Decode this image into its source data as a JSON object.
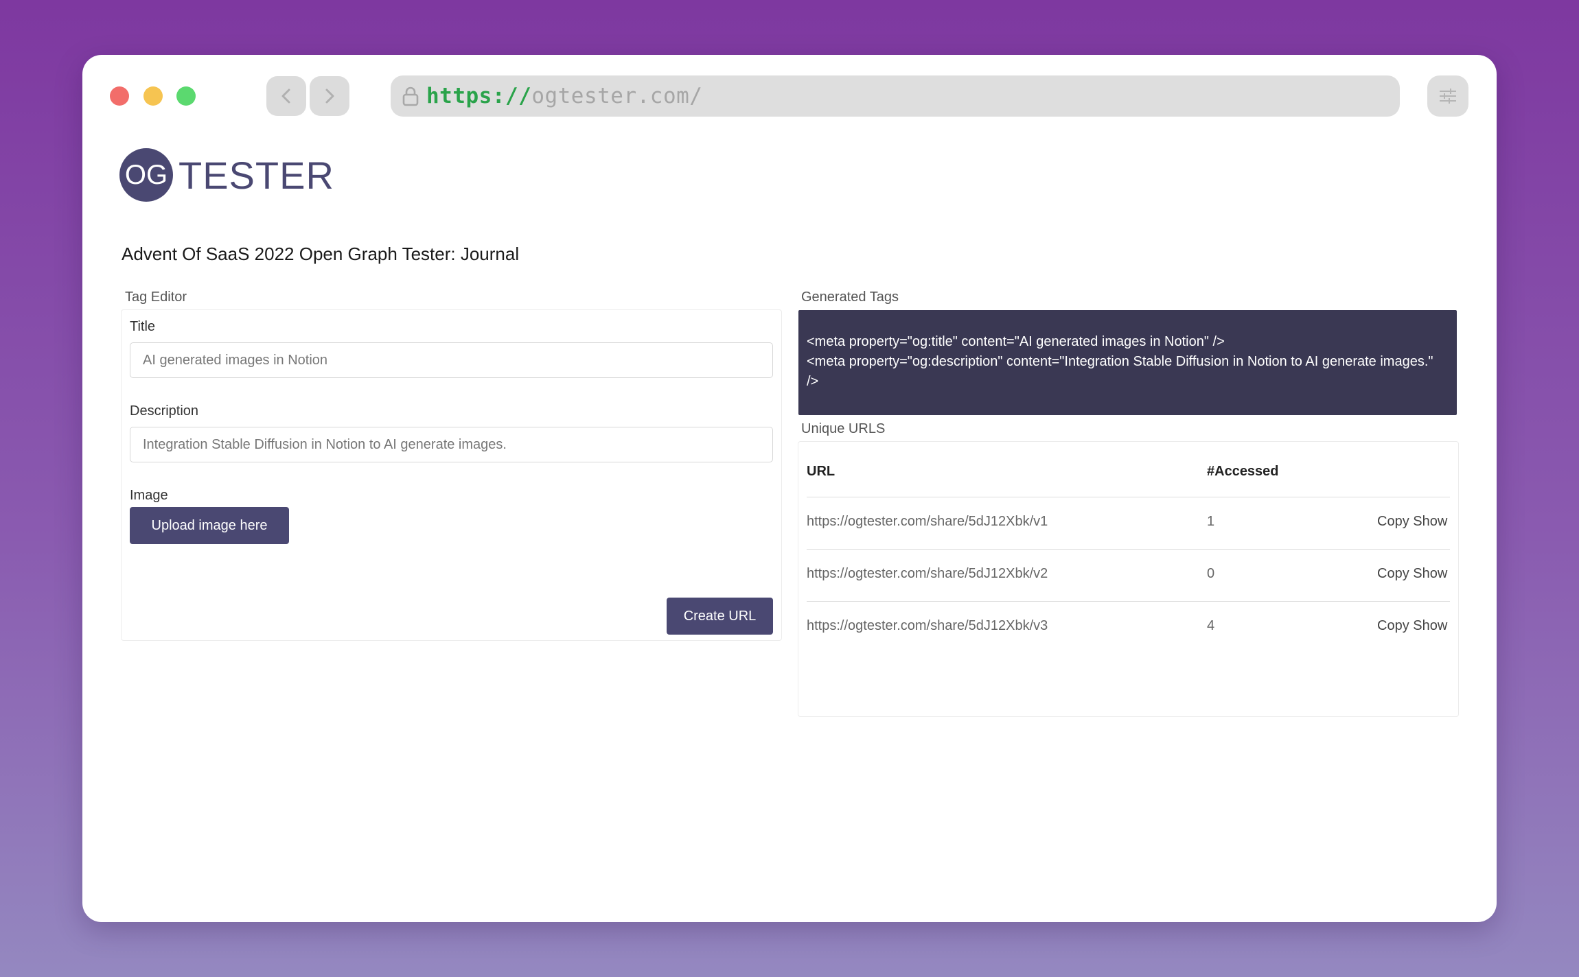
{
  "browser": {
    "url_scheme": "https://",
    "url_host": "ogtester.com/"
  },
  "logo": {
    "badge": "OG",
    "word": "TESTER"
  },
  "page_title": "Advent Of SaaS 2022 Open Graph Tester: Journal",
  "tag_editor": {
    "section_label": "Tag Editor",
    "title_label": "Title",
    "title_value": "AI generated images in Notion",
    "description_label": "Description",
    "description_value": "Integration Stable Diffusion in Notion to AI generate images.",
    "image_label": "Image",
    "upload_button": "Upload image here",
    "create_button": "Create URL"
  },
  "generated_tags": {
    "section_label": "Generated Tags",
    "line1": "<meta property=\"og:title\" content=\"AI generated images in Notion\" />",
    "line2": "<meta property=\"og:description\" content=\"Integration Stable Diffusion in Notion to AI generate images.\" />"
  },
  "unique_urls": {
    "section_label": "Unique URLS",
    "col_url": "URL",
    "col_accessed": "#Accessed",
    "rows": [
      {
        "url": "https://ogtester.com/share/5dJ12Xbk/v1",
        "accessed": "1",
        "copy": "Copy",
        "show": "Show"
      },
      {
        "url": "https://ogtester.com/share/5dJ12Xbk/v2",
        "accessed": "0",
        "copy": "Copy",
        "show": "Show"
      },
      {
        "url": "https://ogtester.com/share/5dJ12Xbk/v3",
        "accessed": "4",
        "copy": "Copy",
        "show": "Show"
      }
    ]
  },
  "colors": {
    "brand": "#4a4872",
    "code_bg": "#3a3853",
    "url_scheme": "#2aa34a"
  },
  "icons": [
    "back-chevron-icon",
    "forward-chevron-icon",
    "lock-icon",
    "sliders-icon"
  ]
}
